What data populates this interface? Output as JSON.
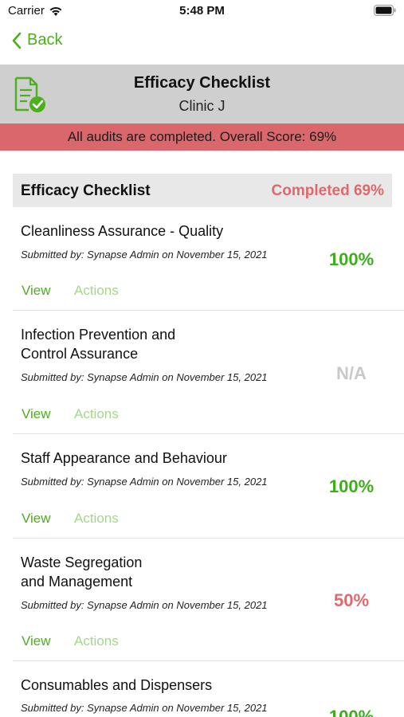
{
  "status_bar": {
    "carrier": "Carrier",
    "time": "5:48 PM",
    "icons": [
      "wifi-icon",
      "battery-icon"
    ]
  },
  "nav": {
    "back_label": "Back",
    "back_icon": "chevron-left-icon",
    "accent_color": "#4caf1c"
  },
  "header": {
    "icon": "checklist-document-icon",
    "title": "Efficacy Checklist",
    "subtitle": "Clinic J"
  },
  "banner": {
    "text": "All audits are completed. Overall Score: 69%",
    "color": "#d9676b"
  },
  "section": {
    "title": "Efficacy Checklist",
    "status": "Completed 69%",
    "status_color": "#e0686c"
  },
  "items": [
    {
      "title_lines": [
        "Cleanliness Assurance - Quality"
      ],
      "submitted": "Submitted by: Synapse Admin on November 15, 2021",
      "score": "100%",
      "score_color": "#3fae1c",
      "view_label": "View",
      "actions_label": "Actions"
    },
    {
      "title_lines": [
        "Infection Prevention and",
        "Control Assurance"
      ],
      "submitted": "Submitted by: Synapse Admin on November 15, 2021",
      "score": "N/A",
      "score_color": "#c9c9c9",
      "view_label": "View",
      "actions_label": "Actions"
    },
    {
      "title_lines": [
        "Staff Appearance and Behaviour"
      ],
      "submitted": "Submitted by: Synapse Admin on November 15, 2021",
      "score": "100%",
      "score_color": "#3fae1c",
      "view_label": "View",
      "actions_label": "Actions"
    },
    {
      "title_lines": [
        "Waste Segregation",
        "and Management"
      ],
      "submitted": "Submitted by: Synapse Admin on November 15, 2021",
      "score": "50%",
      "score_color": "#de6a6e",
      "view_label": "View",
      "actions_label": "Actions"
    },
    {
      "title_lines": [
        "Consumables and Dispensers"
      ],
      "submitted": "Submitted by: Synapse Admin on November 15, 2021",
      "score": "100%",
      "score_color": "#3fae1c"
    }
  ]
}
